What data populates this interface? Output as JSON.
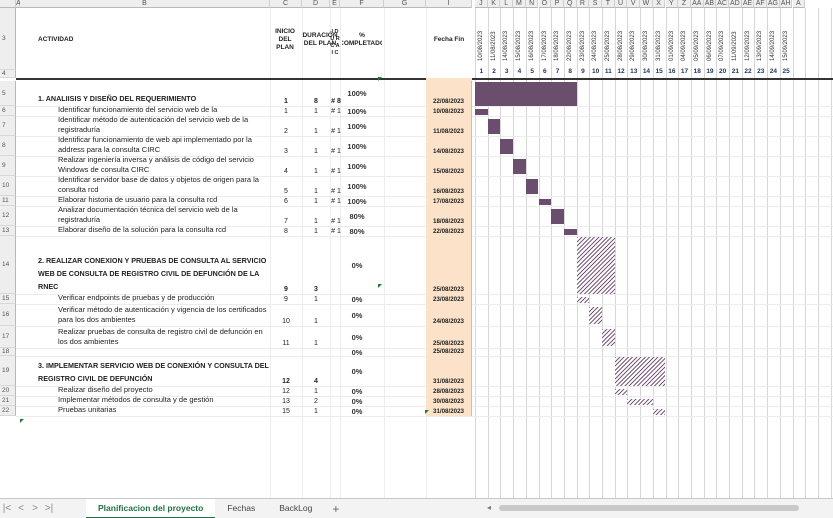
{
  "columns": [
    "A",
    "B",
    "C",
    "D",
    "E",
    "F",
    "G",
    "I",
    "J",
    "K",
    "L",
    "M",
    "N",
    "O",
    "P",
    "Q",
    "R",
    "S",
    "T",
    "U",
    "V",
    "W",
    "X",
    "Y",
    "Z",
    "AA",
    "AB",
    "AC",
    "AD",
    "AE",
    "AF",
    "AG",
    "AH",
    "A"
  ],
  "header": {
    "actividad": "ACTIVIDAD",
    "inicio": "INICIO DEL PLAN",
    "duracion": "DURACIÓN DEL PLAN",
    "e_col": "I D U R C A I C",
    "completa": "% COMPLETADO",
    "fecha_fin": "Fecha Fin",
    "dates": [
      "10/08/2023",
      "11/08/2023",
      "14/08/2023",
      "15/08/2023",
      "16/08/2023",
      "17/08/2023",
      "18/08/2023",
      "22/08/2023",
      "23/08/2023",
      "24/08/2023",
      "25/08/2023",
      "28/08/2023",
      "29/08/2023",
      "30/08/2023",
      "31/08/2023",
      "01/09/2023",
      "04/09/2023",
      "05/09/2023",
      "06/09/2023",
      "07/09/2023",
      "11/09/2023",
      "12/09/2023",
      "13/09/2023",
      "14/09/2023",
      "15/09/2023"
    ],
    "day_numbers": [
      "1",
      "2",
      "3",
      "4",
      "5",
      "6",
      "7",
      "8",
      "9",
      "10",
      "11",
      "12",
      "13",
      "14",
      "15",
      "16",
      "17",
      "18",
      "19",
      "20",
      "21",
      "22",
      "23",
      "24",
      "25"
    ]
  },
  "row_numbers": [
    "3",
    "4",
    "5",
    "6",
    "7",
    "8",
    "9",
    "10",
    "11",
    "12",
    "13",
    "14",
    "15",
    "16",
    "17",
    "18",
    "19",
    "20",
    "21",
    "22"
  ],
  "rows": [
    {
      "row": "5",
      "name": "1. ANALIISIS Y DISEÑO DEL REQUERIMIENTO",
      "section": true,
      "inicio": "1",
      "duracion": "8",
      "e": "# 8",
      "pct": "100%",
      "fin": "22/08/2023"
    },
    {
      "row": "6",
      "name": "Identificar funcionamiento del servicio web de la",
      "section": false,
      "inicio": "1",
      "duracion": "1",
      "e": "# 1",
      "pct": "100%",
      "fin": "10/08/2023"
    },
    {
      "row": "7",
      "name": "Identificar método de autenticación del servicio web de la registraduría",
      "section": false,
      "inicio": "2",
      "duracion": "1",
      "e": "# 1",
      "pct": "100%",
      "fin": "11/08/2023"
    },
    {
      "row": "8",
      "name": "Identificar funcionamiento de web api implementado por la address para la consulta CIRC",
      "section": false,
      "inicio": "3",
      "duracion": "1",
      "e": "# 1",
      "pct": "100%",
      "fin": "14/08/2023"
    },
    {
      "row": "9",
      "name": "Realizar ingeniería inversa y análisis de código del servicio Windows de consulta CIRC",
      "section": false,
      "inicio": "4",
      "duracion": "1",
      "e": "# 1",
      "pct": "100%",
      "fin": "15/08/2023"
    },
    {
      "row": "10",
      "name": "Identificar servidor base de datos y objetos de origen para la consulta rcd",
      "section": false,
      "inicio": "5",
      "duracion": "1",
      "e": "# 1",
      "pct": "100%",
      "fin": "16/08/2023"
    },
    {
      "row": "11",
      "name": "Elaborar historia de usuario para la consulta rcd",
      "section": false,
      "inicio": "6",
      "duracion": "1",
      "e": "# 1",
      "pct": "100%",
      "fin": "17/08/2023"
    },
    {
      "row": "12",
      "name": "Analizar documentación técnica del servicio web de la registraduría",
      "section": false,
      "inicio": "7",
      "duracion": "1",
      "e": "# 1",
      "pct": "80%",
      "fin": "18/08/2023"
    },
    {
      "row": "13",
      "name": "Elaborar diseño de la solución para la consulta rcd",
      "section": false,
      "inicio": "8",
      "duracion": "1",
      "e": "# 1",
      "pct": "80%",
      "fin": "22/08/2023"
    },
    {
      "row": "14",
      "name": "2. REALIZAR CONEXION Y PRUEBAS DE CONSULTA AL SERVICIO WEB DE CONSULTA DE REGISTRO CIVIL DE DEFUNCIÓN DE LA  RNEC",
      "section": true,
      "inicio": "9",
      "duracion": "3",
      "e": "",
      "pct": "0%",
      "fin": "25/08/2023"
    },
    {
      "row": "15",
      "name": "Verificar endpoints de pruebas y de producción",
      "section": false,
      "inicio": "9",
      "duracion": "1",
      "e": "",
      "pct": "0%",
      "fin": "23/08/2023"
    },
    {
      "row": "16",
      "name": "Verificar método de autenticación y vigencia de los certificados para los dos ambientes",
      "section": false,
      "inicio": "10",
      "duracion": "1",
      "e": "",
      "pct": "0%",
      "fin": "24/08/2023"
    },
    {
      "row": "17",
      "name": "Realizar pruebas de consulta de registro civil de defunción en los dos ambientes",
      "section": false,
      "inicio": "11",
      "duracion": "1",
      "e": "",
      "pct": "0%",
      "fin": "25/08/2023"
    },
    {
      "row": "18",
      "name": "",
      "section": false,
      "inicio": "",
      "duracion": "",
      "e": "",
      "pct": "0%",
      "fin": "25/08/2023"
    },
    {
      "row": "19",
      "name": "3. IMPLEMENTAR SERVICIO WEB DE CONEXIÓN Y CONSULTA DEL REGISTRO CIVIL DE DEFUNCIÓN",
      "section": true,
      "inicio": "12",
      "duracion": "4",
      "e": "",
      "pct": "0%",
      "fin": "31/08/2023"
    },
    {
      "row": "20",
      "name": "Realizar diseño del proyecto",
      "section": false,
      "inicio": "12",
      "duracion": "1",
      "e": "",
      "pct": "0%",
      "fin": "28/08/2023"
    },
    {
      "row": "21",
      "name": "Implementar métodos de consulta y de gestión",
      "section": false,
      "inicio": "13",
      "duracion": "2",
      "e": "",
      "pct": "0%",
      "fin": "30/08/2023"
    },
    {
      "row": "22",
      "name": "Pruebas unitarias",
      "section": false,
      "inicio": "15",
      "duracion": "1",
      "e": "",
      "pct": "0%",
      "fin": "31/08/2023"
    }
  ],
  "tabs": [
    "Planificacion del proyecto",
    "Fechas",
    "BackLog"
  ],
  "active_tab": "Planificacion del proyecto",
  "colors": {
    "bar_done": "#6b4d6e",
    "fecha_fin_bg": "#fbe2c8",
    "active_tab": "#1e7145"
  }
}
